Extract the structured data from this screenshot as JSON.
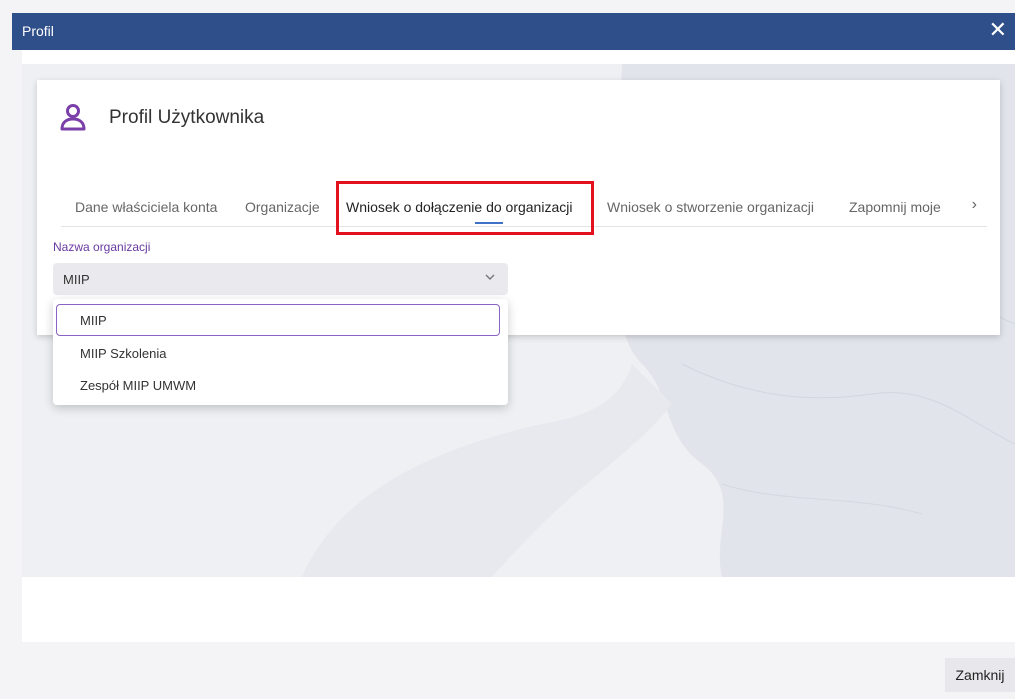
{
  "window": {
    "title": "Profil",
    "close_icon": "close-icon"
  },
  "card": {
    "title": "Profil Użytkownika",
    "icon": "user-icon",
    "accent": "#7a3fa8"
  },
  "tabs": [
    {
      "label": "Dane właściciela konta"
    },
    {
      "label": "Organizacje"
    },
    {
      "label": "Wniosek o dołączenie do organizacji",
      "active": true
    },
    {
      "label": "Wniosek o stworzenie organizacji"
    },
    {
      "label": "Zapomnij moje"
    }
  ],
  "form": {
    "label": "Nazwa organizacji",
    "selected": "MIIP",
    "options": [
      "MIIP",
      "MIIP Szkolenia",
      "Zespół MIIP UMWM"
    ]
  },
  "footer": {
    "close_label": "Zamknij"
  },
  "colors": {
    "titlebar": "#2f4f8a",
    "highlight": "#e2121f",
    "tab_underline": "#3f72c6",
    "label": "#6a3aa0"
  }
}
